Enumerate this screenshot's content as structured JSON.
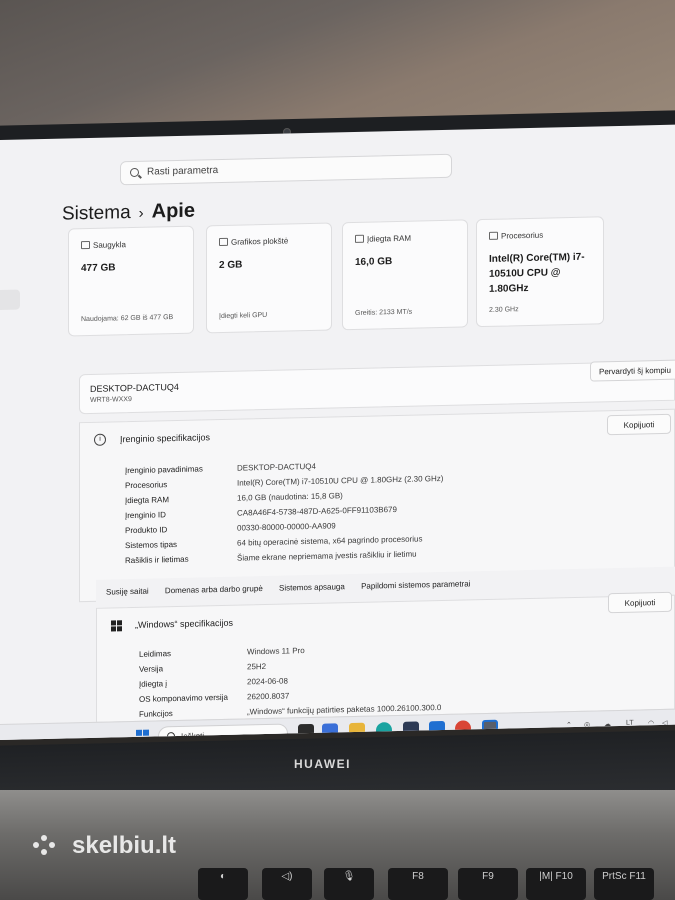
{
  "search": {
    "placeholder": "Rasti parametra"
  },
  "breadcrumb": {
    "parent": "Sistema",
    "separator": "›",
    "current": "Apie"
  },
  "cards": [
    {
      "label": "Saugykla",
      "value": "477 GB",
      "sub": "Naudojama: 62 GB iš 477 GB"
    },
    {
      "label": "Grafikos plokštė",
      "value": "2 GB",
      "sub": "Įdiegti keli GPU"
    },
    {
      "label": "Įdiegta RAM",
      "value": "16,0 GB",
      "sub": "Greitis: 2133 MT/s"
    },
    {
      "label": "Procesorius",
      "value": "Intel(R) Core(TM) i7-10510U CPU @ 1.80GHz",
      "sub": "2.30 GHz"
    }
  ],
  "device": {
    "name": "DESKTOP-DACTUQ4",
    "group": "WRT8-WXX9",
    "rename_label": "Pervardyti šį kompiu"
  },
  "device_spec": {
    "title": "Įrenginio specifikacijos",
    "copy_label": "Kopijuoti",
    "rows": [
      {
        "k": "Įrenginio pavadinimas",
        "v": "DESKTOP-DACTUQ4"
      },
      {
        "k": "Procesorius",
        "v": "Intel(R) Core(TM) i7-10510U CPU @ 1.80GHz (2.30 GHz)"
      },
      {
        "k": "Įdiegta RAM",
        "v": "16,0 GB (naudotina: 15,8 GB)"
      },
      {
        "k": "Įrenginio ID",
        "v": "CA8A46F4-5738-487D-A625-0FF91103B679"
      },
      {
        "k": "Produkto ID",
        "v": "00330-80000-00000-AA909"
      },
      {
        "k": "Sistemos tipas",
        "v": "64 bitų operacinė sistema, x64 pagrindo procesorius"
      },
      {
        "k": "Rašiklis ir lietimas",
        "v": "Šiame ekrane nepriemama įvestis rašikliu ir lietimu"
      }
    ]
  },
  "related": {
    "label": "Susiję saitai",
    "links": [
      "Domenas arba darbo grupė",
      "Sistemos apsauga",
      "Papildomi sistemos parametrai"
    ]
  },
  "windows_spec": {
    "title": "„Windows“ specifikacijos",
    "copy_label": "Kopijuoti",
    "rows": [
      {
        "k": "Leidimas",
        "v": "Windows 11 Pro"
      },
      {
        "k": "Versija",
        "v": "25H2"
      },
      {
        "k": "Įdiegta į",
        "v": "2024-06-08"
      },
      {
        "k": "OS komponavimo versija",
        "v": "26200.8037"
      },
      {
        "k": "Funkcijos",
        "v": "„Windows“ funkcijų patirties paketas 1000.26100.300.0"
      }
    ]
  },
  "taskbar": {
    "search_placeholder": "Ieškoti",
    "tray_lang": "LT"
  },
  "hardware": {
    "brand": "HUAWEI",
    "keys": [
      "F8",
      "F9",
      "F10",
      "PrtSc F11"
    ],
    "key_f10_glyph": "|M|"
  },
  "watermark": {
    "text": "skelbiu.lt"
  },
  "colors": {
    "accent": "#1f6fd1",
    "background": "#f2f2f4",
    "card": "#fbfbfc"
  }
}
